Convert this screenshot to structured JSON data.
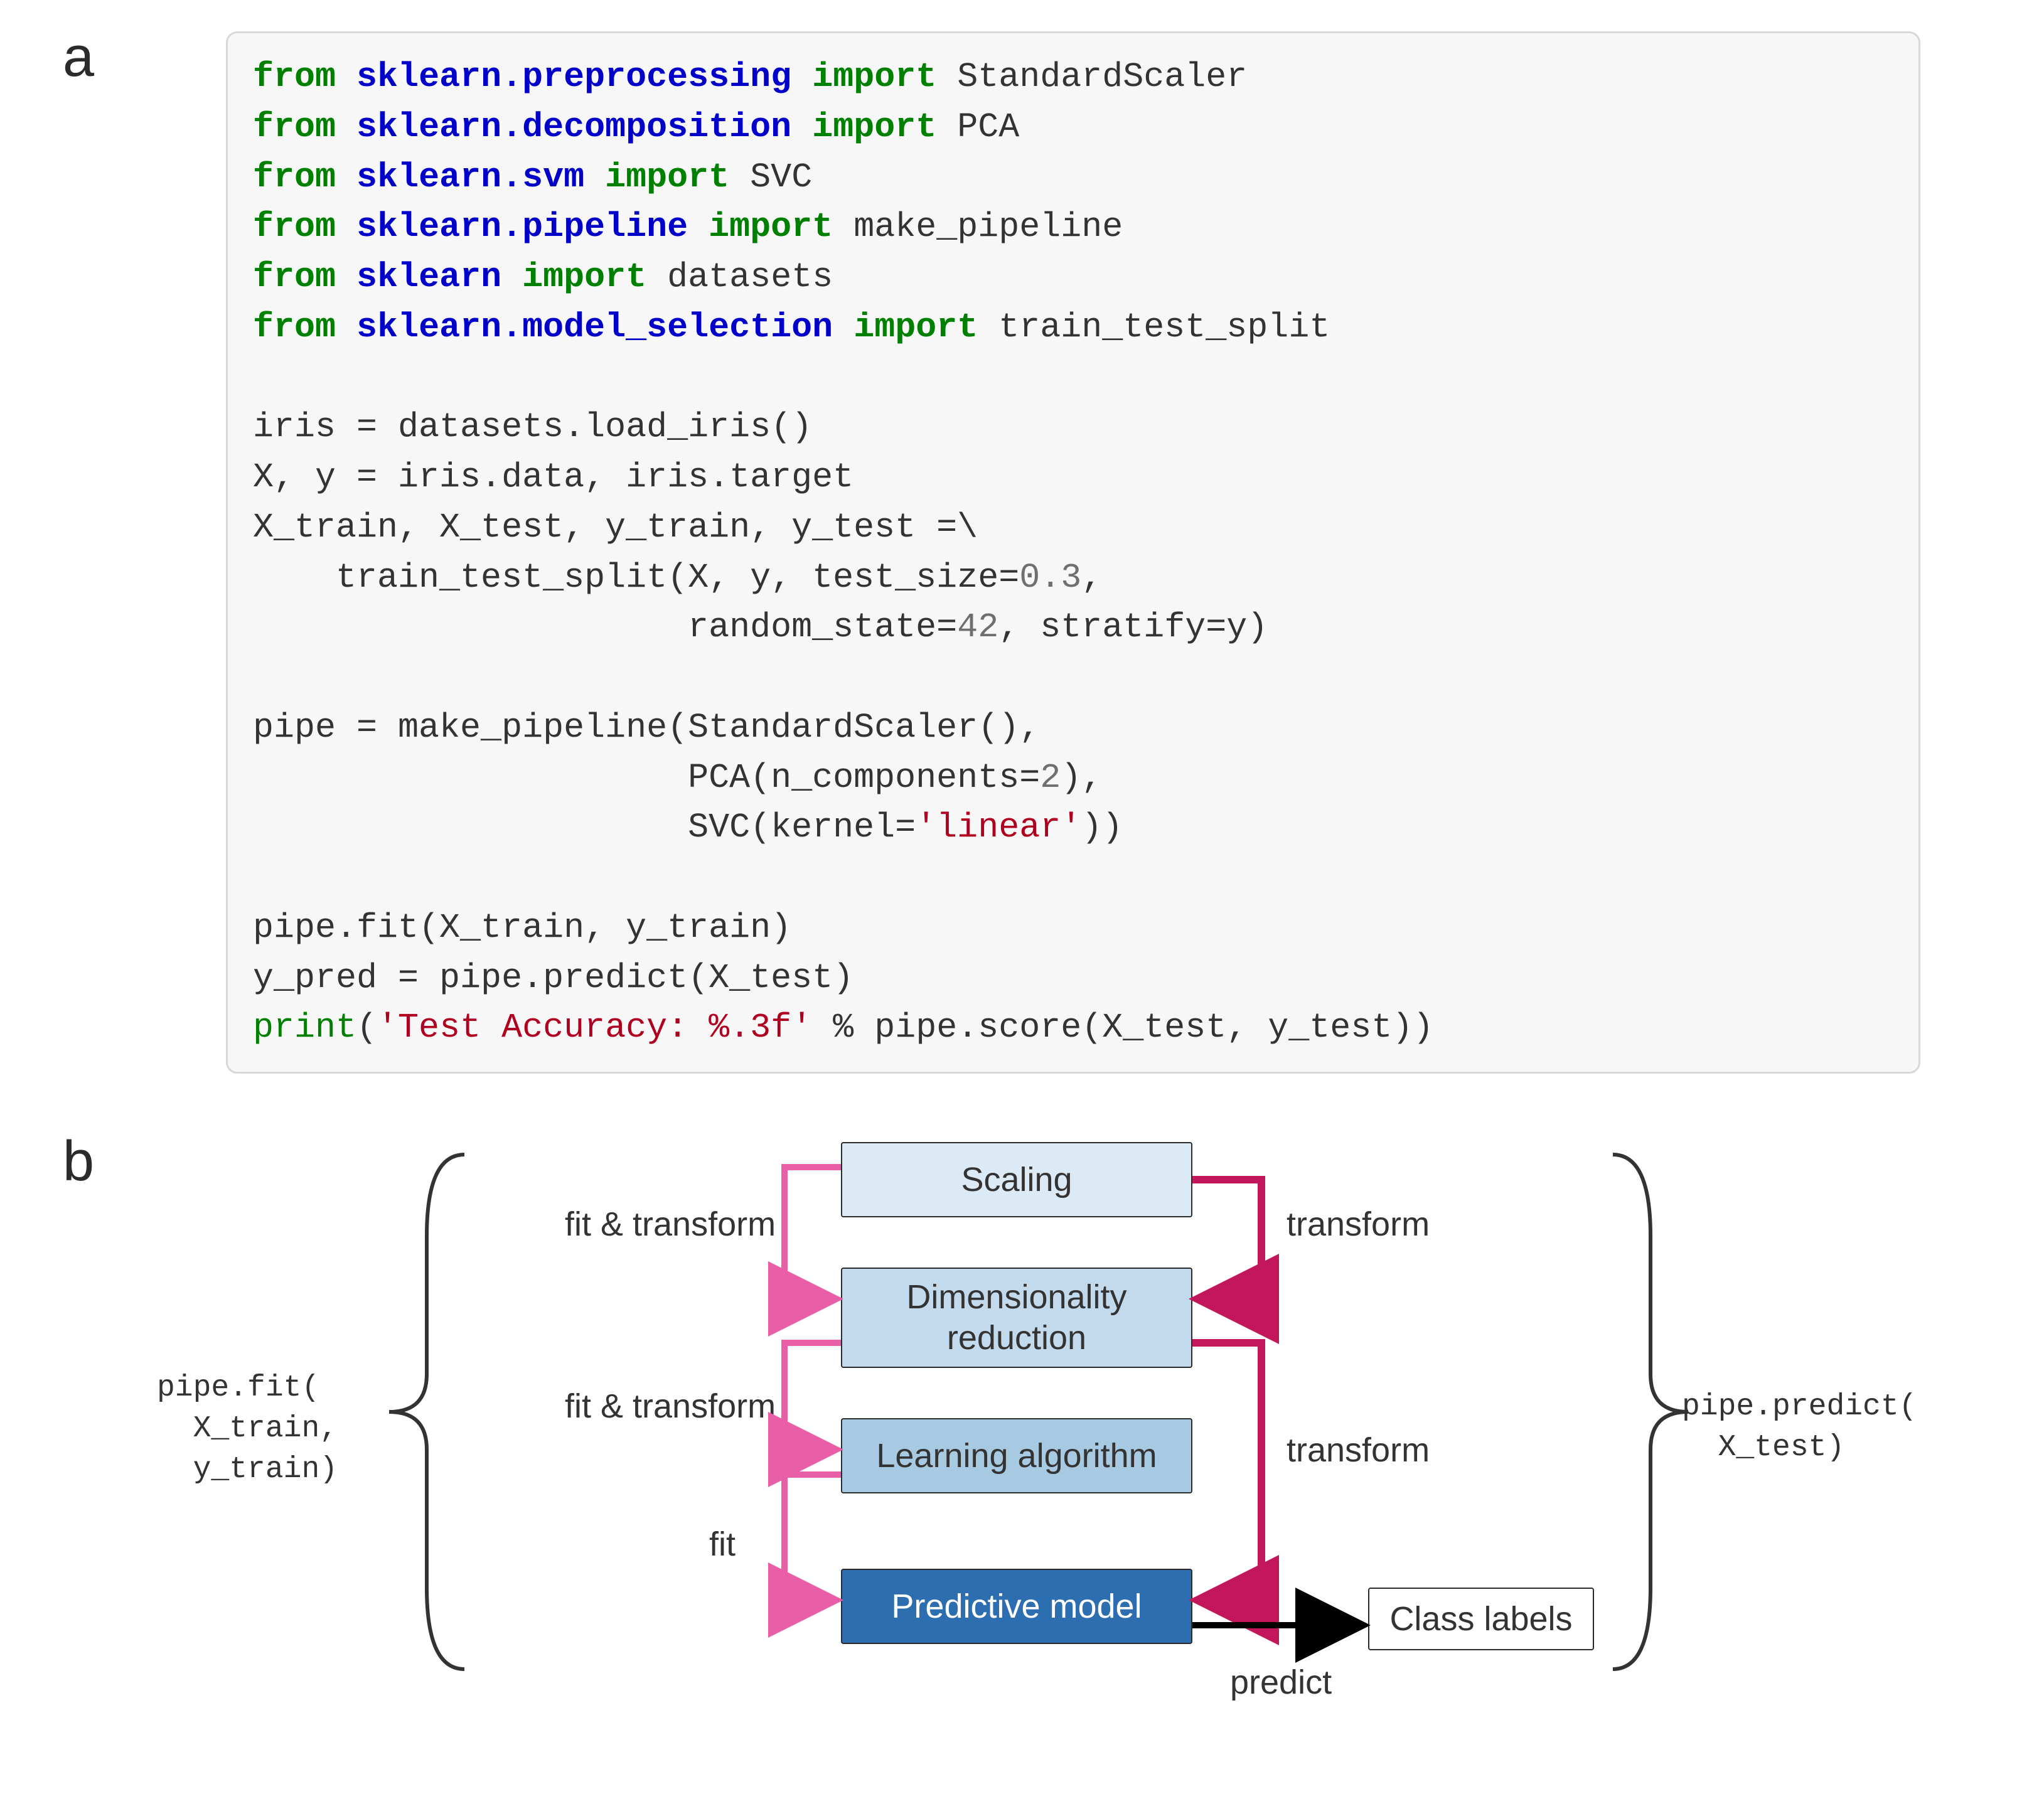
{
  "labels": {
    "a": "a",
    "b": "b"
  },
  "code": {
    "tokens": [
      [
        "kw-green",
        "from"
      ],
      [
        "p",
        " "
      ],
      [
        "kw-blue",
        "sklearn.preprocessing"
      ],
      [
        "p",
        " "
      ],
      [
        "kw-green",
        "import"
      ],
      [
        "p",
        " StandardScaler\n"
      ],
      [
        "kw-green",
        "from"
      ],
      [
        "p",
        " "
      ],
      [
        "kw-blue",
        "sklearn.decomposition"
      ],
      [
        "p",
        " "
      ],
      [
        "kw-green",
        "import"
      ],
      [
        "p",
        " PCA\n"
      ],
      [
        "kw-green",
        "from"
      ],
      [
        "p",
        " "
      ],
      [
        "kw-blue",
        "sklearn.svm"
      ],
      [
        "p",
        " "
      ],
      [
        "kw-green",
        "import"
      ],
      [
        "p",
        " SVC\n"
      ],
      [
        "kw-green",
        "from"
      ],
      [
        "p",
        " "
      ],
      [
        "kw-blue",
        "sklearn.pipeline"
      ],
      [
        "p",
        " "
      ],
      [
        "kw-green",
        "import"
      ],
      [
        "p",
        " make_pipeline\n"
      ],
      [
        "kw-green",
        "from"
      ],
      [
        "p",
        " "
      ],
      [
        "kw-blue",
        "sklearn"
      ],
      [
        "p",
        " "
      ],
      [
        "kw-green",
        "import"
      ],
      [
        "p",
        " datasets\n"
      ],
      [
        "kw-green",
        "from"
      ],
      [
        "p",
        " "
      ],
      [
        "kw-blue",
        "sklearn.model_selection"
      ],
      [
        "p",
        " "
      ],
      [
        "kw-green",
        "import"
      ],
      [
        "p",
        " train_test_split\n\n"
      ],
      [
        "p",
        "iris = datasets.load_iris()\n"
      ],
      [
        "p",
        "X, y = iris.data, iris.target\n"
      ],
      [
        "p",
        "X_train, X_test, y_train, y_test =\\\n"
      ],
      [
        "p",
        "    train_test_split(X, y, test_size="
      ],
      [
        "num",
        "0.3"
      ],
      [
        "p",
        ",\n"
      ],
      [
        "p",
        "                     random_state="
      ],
      [
        "num",
        "42"
      ],
      [
        "p",
        ", stratify=y)\n\n"
      ],
      [
        "p",
        "pipe = make_pipeline(StandardScaler(),\n"
      ],
      [
        "p",
        "                     PCA(n_components="
      ],
      [
        "num",
        "2"
      ],
      [
        "p",
        "),\n"
      ],
      [
        "p",
        "                     SVC(kernel="
      ],
      [
        "str",
        "'linear'"
      ],
      [
        "p",
        "))\n\n"
      ],
      [
        "p",
        "pipe.fit(X_train, y_train)\n"
      ],
      [
        "p",
        "y_pred = pipe.predict(X_test)\n"
      ],
      [
        "builtin",
        "print"
      ],
      [
        "p",
        "("
      ],
      [
        "str",
        "'Test Accuracy: %.3f'"
      ],
      [
        "p",
        " % pipe.score(X_test, y_test))"
      ]
    ]
  },
  "diagram": {
    "boxes": {
      "scaling": "Scaling",
      "dimred": "Dimensionality\nreduction",
      "learn": "Learning algorithm",
      "model": "Predictive model",
      "classlabels": "Class labels"
    },
    "arrows": {
      "fit_transform": "fit & transform",
      "fit": "fit",
      "transform": "transform",
      "predict": "predict"
    },
    "calls": {
      "fit": "pipe.fit(\n  X_train,\n  y_train)",
      "predict": "pipe.predict(\n  X_test)"
    }
  }
}
